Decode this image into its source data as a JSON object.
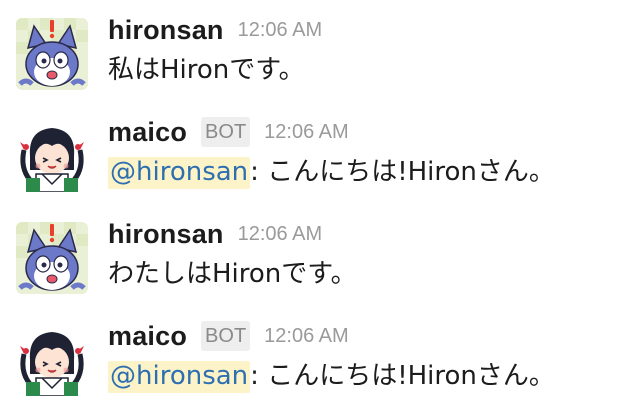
{
  "messages": [
    {
      "user": "hironsan",
      "is_bot": false,
      "time": "12:06 AM",
      "text": "私はHironです。"
    },
    {
      "user": "maico",
      "is_bot": true,
      "bot_label": "BOT",
      "time": "12:06 AM",
      "mention": "@hironsan",
      "text": ": こんにちは!Hironさん。"
    },
    {
      "user": "hironsan",
      "is_bot": false,
      "time": "12:06 AM",
      "text": "わたしはHironです。"
    },
    {
      "user": "maico",
      "is_bot": true,
      "bot_label": "BOT",
      "time": "12:06 AM",
      "mention": "@hironsan",
      "text": ": こんにちは!Hironさん。"
    }
  ],
  "icons": {
    "hironsan_avatar": "cat-avatar-icon",
    "maico_avatar": "anime-girl-avatar-icon"
  },
  "colors": {
    "mention_bg": "#fdf3c8",
    "mention_text": "#2e6fb0",
    "timestamp": "#9a9a9a",
    "bot_badge_bg": "#eeeeee"
  }
}
